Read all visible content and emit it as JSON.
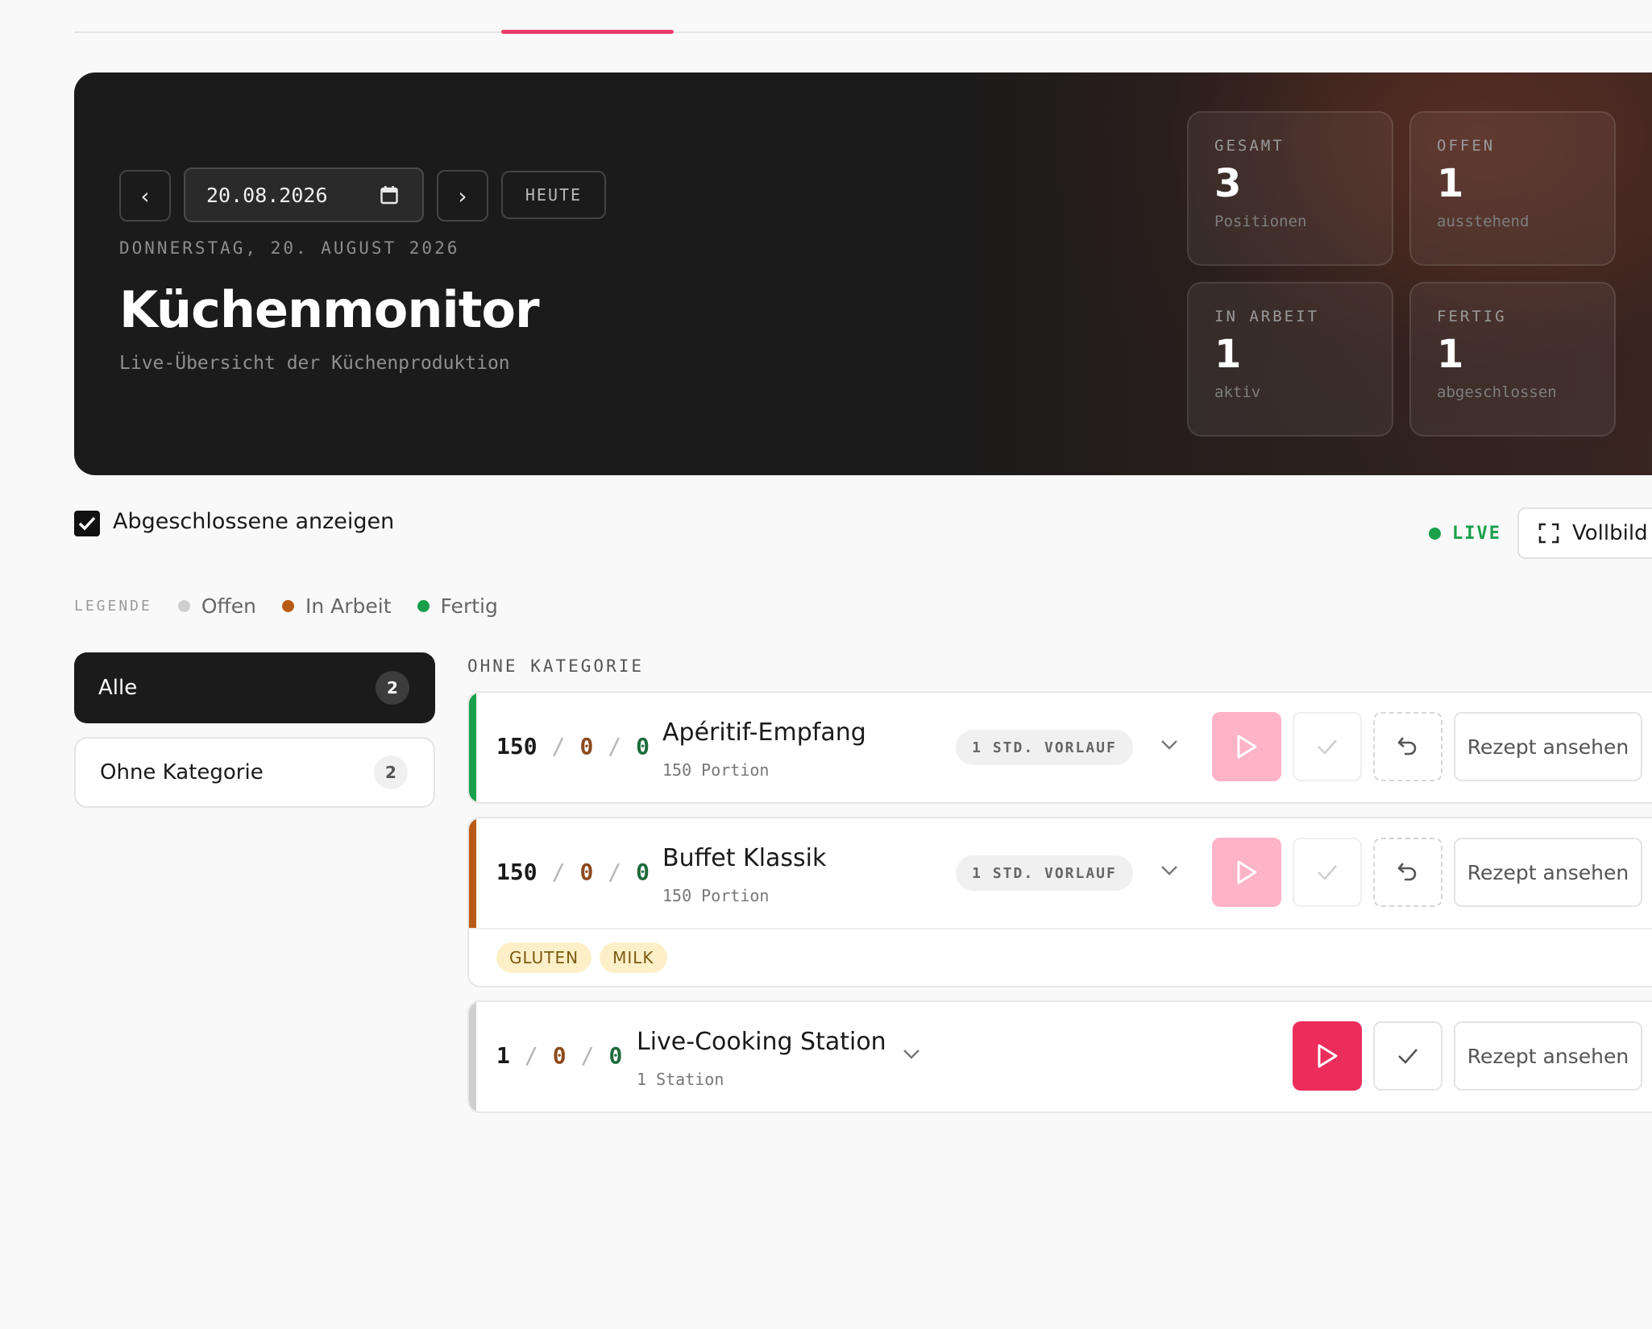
{
  "hero": {
    "date_value": "20.08.2026",
    "prev_label": "‹",
    "next_label": "›",
    "today_label": "HEUTE",
    "date_long": "DONNERSTAG, 20. AUGUST 2026",
    "title": "Küchenmonitor",
    "subtitle": "Live-Übersicht der Küchenproduktion",
    "stats": [
      {
        "label": "GESAMT",
        "value": "3",
        "caption": "Positionen"
      },
      {
        "label": "OFFEN",
        "value": "1",
        "caption": "ausstehend"
      },
      {
        "label": "IN ARBEIT",
        "value": "1",
        "caption": "aktiv"
      },
      {
        "label": "FERTIG",
        "value": "1",
        "caption": "abgeschlossen"
      }
    ]
  },
  "filters": {
    "show_completed_label": "Abgeschlossene anzeigen",
    "show_completed_checked": true,
    "live_label": "LIVE",
    "fullscreen_label": "Vollbild"
  },
  "legend": {
    "title": "LEGENDE",
    "items": [
      {
        "label": "Offen",
        "color": "#cfcfcf"
      },
      {
        "label": "In Arbeit",
        "color": "#b85a14"
      },
      {
        "label": "Fertig",
        "color": "#1aa04a"
      }
    ]
  },
  "sidebar": {
    "items": [
      {
        "label": "Alle",
        "count": "2",
        "active": true
      },
      {
        "label": "Ohne Kategorie",
        "count": "2",
        "active": false
      }
    ]
  },
  "category": {
    "title": "OHNE KATEGORIE",
    "sep": "/",
    "recipe_label": "Rezept ansehen",
    "items": [
      {
        "total": "150",
        "in_work": "0",
        "done": "0",
        "name": "Apéritif-Empfang",
        "qty": "150 Portion",
        "lead": "1 STD. VORLAUF",
        "bar_color": "#1aa04a",
        "allergens": []
      },
      {
        "total": "150",
        "in_work": "0",
        "done": "0",
        "name": "Buffet Klassik",
        "qty": "150 Portion",
        "lead": "1 STD. VORLAUF",
        "bar_color": "#b85a14",
        "allergens": [
          "GLUTEN",
          "MILK"
        ]
      },
      {
        "total": "1",
        "in_work": "0",
        "done": "0",
        "name": "Live-Cooking Station",
        "qty": "1 Station",
        "lead": "",
        "bar_color": "#cfcfcf",
        "allergens": []
      }
    ]
  },
  "colors": {
    "accent": "#ec2d5c",
    "live": "#1aa04a"
  }
}
